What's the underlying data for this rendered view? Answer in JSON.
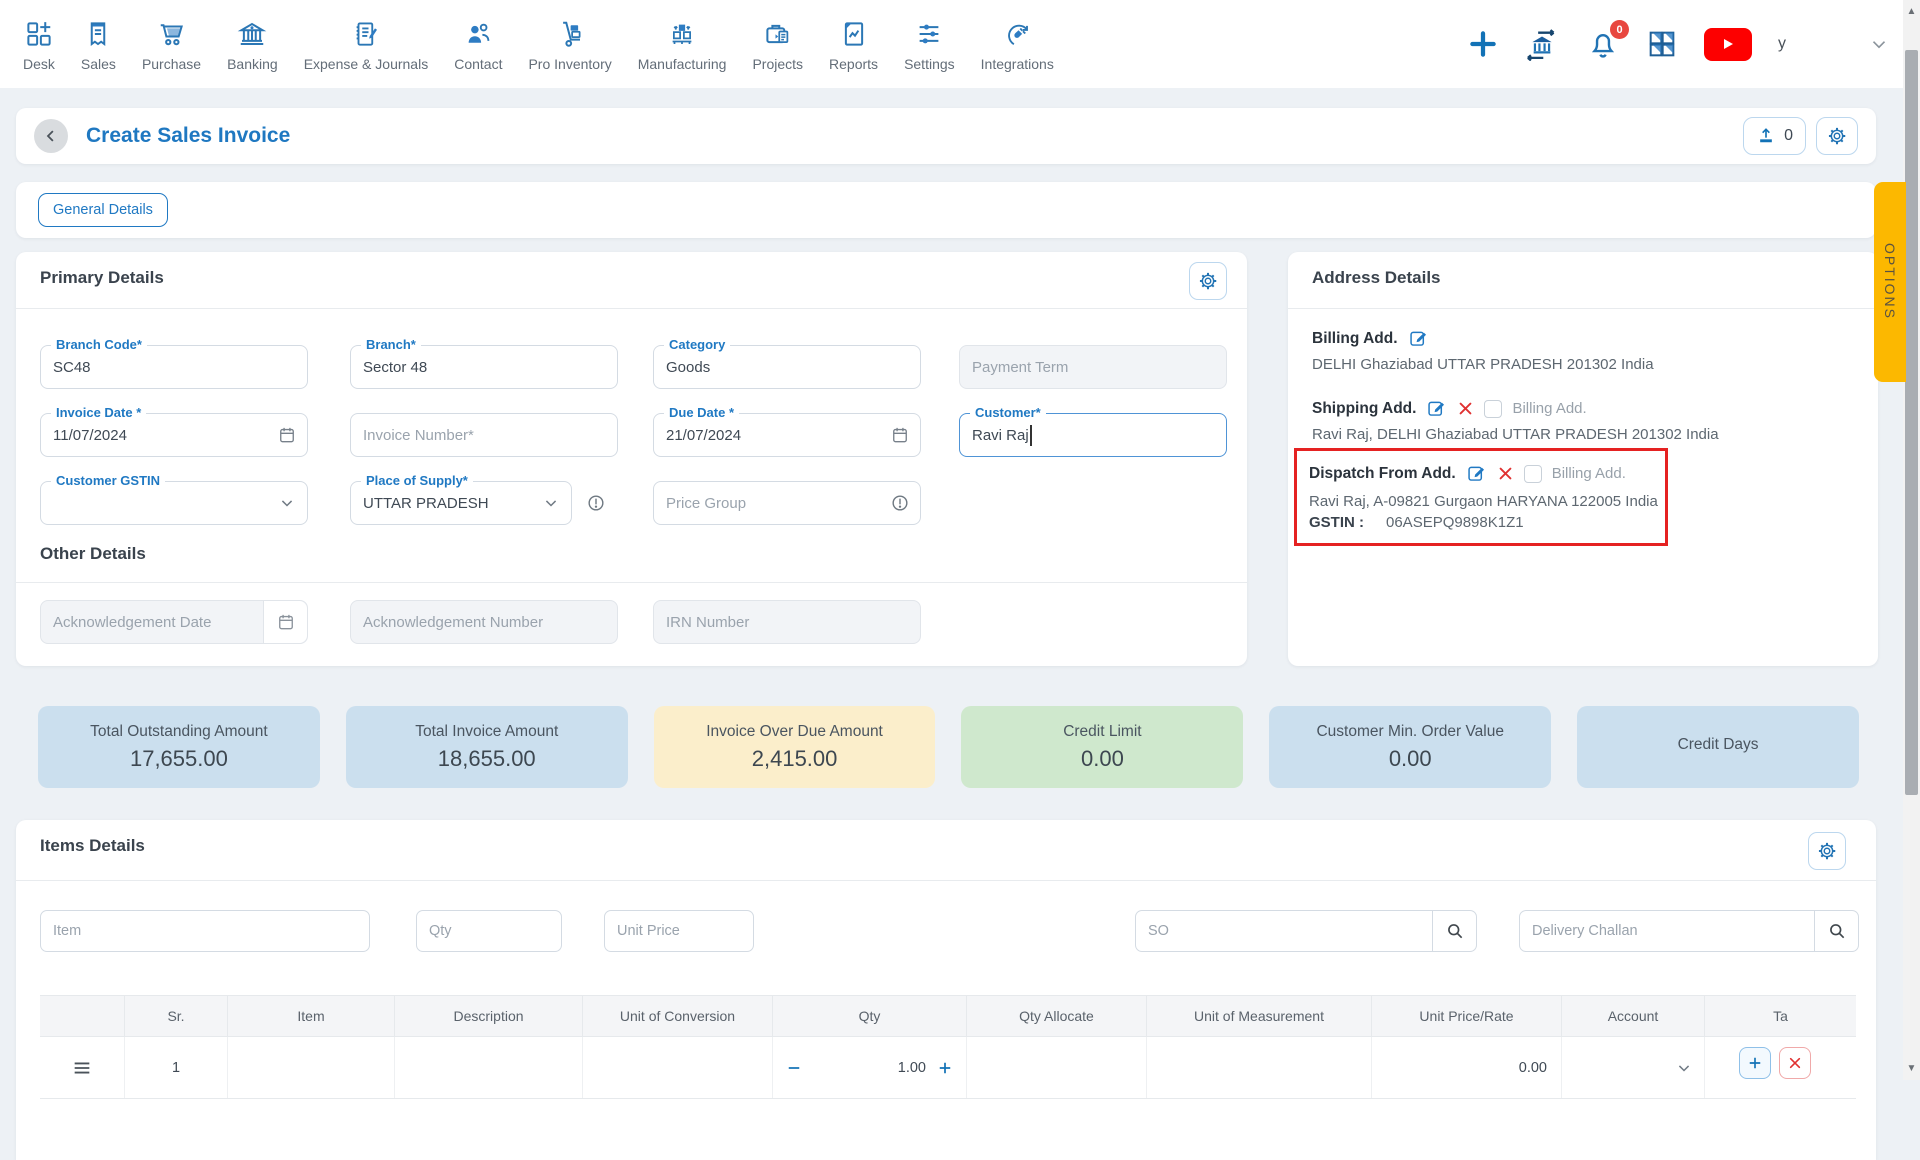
{
  "nav": {
    "items": [
      {
        "label": "Desk"
      },
      {
        "label": "Sales"
      },
      {
        "label": "Purchase"
      },
      {
        "label": "Banking"
      },
      {
        "label": "Expense & Journals"
      },
      {
        "label": "Contact"
      },
      {
        "label": "Pro Inventory"
      },
      {
        "label": "Manufacturing"
      },
      {
        "label": "Projects"
      },
      {
        "label": "Reports"
      },
      {
        "label": "Settings"
      },
      {
        "label": "Integrations"
      }
    ],
    "notification_badge": "0",
    "avatar_text": "y"
  },
  "header": {
    "title": "Create Sales Invoice",
    "upload_count": "0"
  },
  "tabs": {
    "general_details": "General Details"
  },
  "options_tab": "OPTIONS",
  "primary_details": {
    "title": "Primary Details",
    "branch_code": {
      "label": "Branch Code*",
      "value": "SC48"
    },
    "branch": {
      "label": "Branch*",
      "value": "Sector 48"
    },
    "category": {
      "label": "Category",
      "value": "Goods"
    },
    "payment_term": {
      "placeholder": "Payment Term"
    },
    "invoice_date": {
      "label": "Invoice Date *",
      "value": "11/07/2024"
    },
    "invoice_number": {
      "placeholder": "Invoice Number*"
    },
    "due_date": {
      "label": "Due Date *",
      "value": "21/07/2024"
    },
    "customer": {
      "label": "Customer*",
      "value": "Ravi Raj"
    },
    "customer_gstin": {
      "label": "Customer GSTIN",
      "value": ""
    },
    "place_of_supply": {
      "label": "Place of Supply*",
      "value": "UTTAR PRADESH"
    },
    "price_group": {
      "placeholder": "Price Group"
    }
  },
  "other_details": {
    "title": "Other Details",
    "acknowledgement_date": {
      "placeholder": "Acknowledgement Date"
    },
    "acknowledgement_number": {
      "placeholder": "Acknowledgement Number"
    },
    "irn_number": {
      "placeholder": "IRN Number"
    }
  },
  "address_details": {
    "title": "Address Details",
    "billing": {
      "label": "Billing Add.",
      "address": "DELHI Ghaziabad UTTAR PRADESH 201302 India"
    },
    "shipping": {
      "label": "Shipping Add.",
      "checkbox_label": "Billing Add.",
      "address": "Ravi Raj, DELHI Ghaziabad UTTAR PRADESH 201302 India"
    },
    "dispatch": {
      "label": "Dispatch From Add.",
      "checkbox_label": "Billing Add.",
      "address": "Ravi Raj, A-09821 Gurgaon HARYANA 122005 India",
      "gstin_label": "GSTIN :",
      "gstin_value": "06ASEPQ9898K1Z1"
    }
  },
  "summary_cards": [
    {
      "label": "Total Outstanding Amount",
      "value": "17,655.00",
      "color": "#cbdfee"
    },
    {
      "label": "Total Invoice Amount",
      "value": "18,655.00",
      "color": "#cbdfee"
    },
    {
      "label": "Invoice Over Due Amount",
      "value": "2,415.00",
      "color": "#fbeecb"
    },
    {
      "label": "Credit Limit",
      "value": "0.00",
      "color": "#cfe8cd"
    },
    {
      "label": "Customer Min. Order Value",
      "value": "0.00",
      "color": "#cbdfee"
    },
    {
      "label": "Credit Days",
      "value": "",
      "color": "#cbdfee"
    }
  ],
  "items_details": {
    "title": "Items Details",
    "filters": {
      "item": "Item",
      "qty": "Qty",
      "unit_price": "Unit Price",
      "so": "SO",
      "delivery_challan": "Delivery Challan"
    },
    "table": {
      "headers": [
        "Sr.",
        "Item",
        "Description",
        "Unit of Conversion",
        "Qty",
        "Qty Allocate",
        "Unit of Measurement",
        "Unit Price/Rate",
        "Account",
        "Ta"
      ],
      "row": {
        "sr": "1",
        "qty": "1.00",
        "unit_price_rate": "0.00"
      }
    }
  }
}
